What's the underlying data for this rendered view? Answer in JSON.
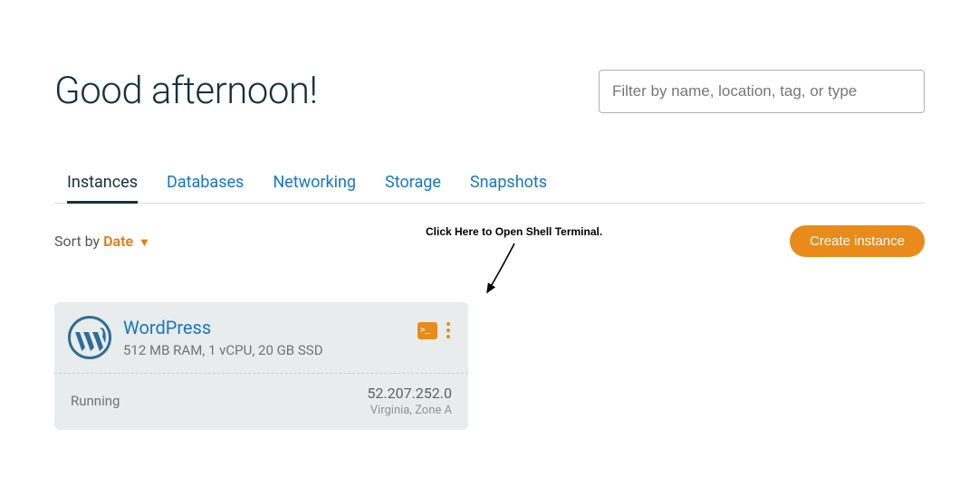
{
  "header": {
    "greeting": "Good afternoon!",
    "filter_placeholder": "Filter by name, location, tag, or type"
  },
  "tabs": {
    "items": [
      "Instances",
      "Databases",
      "Networking",
      "Storage",
      "Snapshots"
    ],
    "active_index": 0
  },
  "sort": {
    "label": "Sort by ",
    "key": "Date"
  },
  "create_button": "Create instance",
  "annotation": "Click Here to Open Shell Terminal.",
  "instance": {
    "name": "WordPress",
    "specs": "512 MB RAM, 1 vCPU, 20 GB SSD",
    "status": "Running",
    "ip": "52.207.252.0",
    "region": "Virginia, Zone A"
  }
}
